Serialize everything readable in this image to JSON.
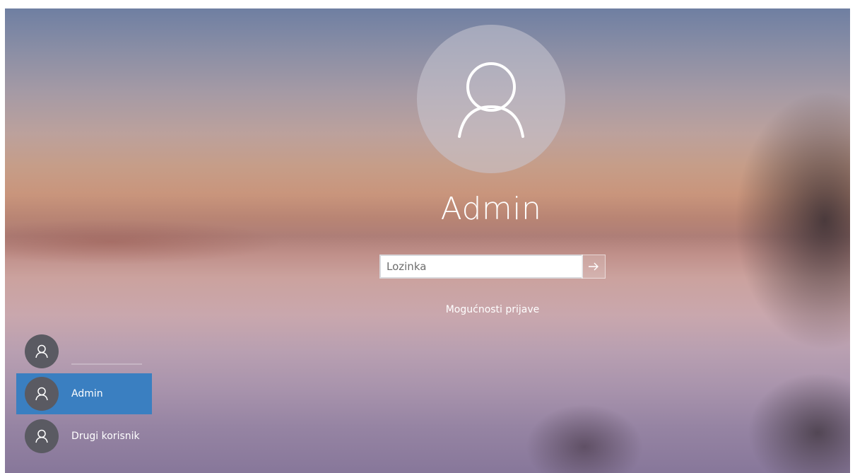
{
  "login": {
    "username": "Admin",
    "password_placeholder": "Lozinka",
    "password_value": "",
    "sign_in_options": "Mogućnosti prijave"
  },
  "icons": {
    "large_avatar": "user-icon",
    "submit": "arrow-right-icon",
    "small_avatar": "user-icon"
  },
  "user_list": [
    {
      "name": "",
      "selected": false
    },
    {
      "name": "Admin",
      "selected": true
    },
    {
      "name": "Drugi korisnik",
      "selected": false
    }
  ],
  "colors": {
    "selection": "#3a7fc1",
    "avatar_bg": "#5a5a62",
    "text": "#ffffff"
  }
}
